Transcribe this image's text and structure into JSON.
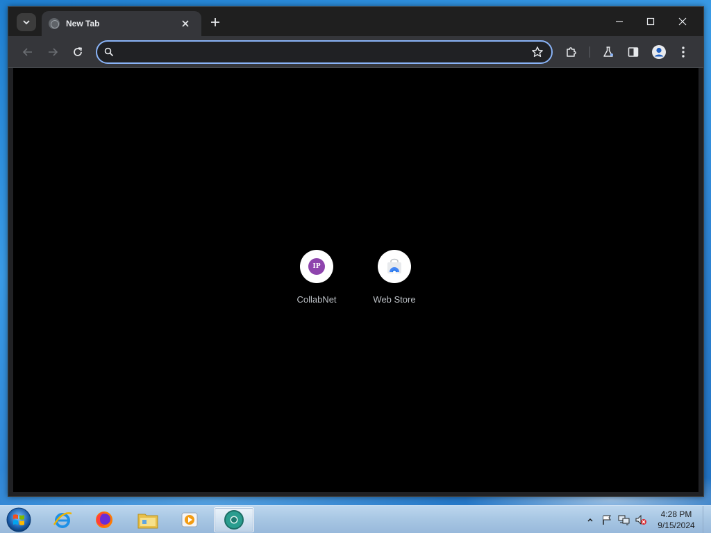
{
  "browser": {
    "tab": {
      "title": "New Tab"
    },
    "omnibox": {
      "value": "",
      "placeholder": ""
    },
    "colors": {
      "accent": "#8ab4f8",
      "toolbar": "#35363a",
      "titlebar": "#1f1f1f",
      "page": "#000000"
    }
  },
  "new_tab_page": {
    "shortcuts": [
      {
        "label": "CollabNet",
        "icon": "collabnet-icon",
        "icon_text": "IP"
      },
      {
        "label": "Web Store",
        "icon": "web-store-icon"
      }
    ]
  },
  "taskbar": {
    "pinned": [
      {
        "name": "internet-explorer-icon"
      },
      {
        "name": "firefox-icon"
      },
      {
        "name": "file-explorer-icon"
      },
      {
        "name": "media-player-icon"
      },
      {
        "name": "chrome-icon",
        "active": true
      }
    ],
    "clock": {
      "time": "4:28 PM",
      "date": "9/15/2024"
    }
  }
}
